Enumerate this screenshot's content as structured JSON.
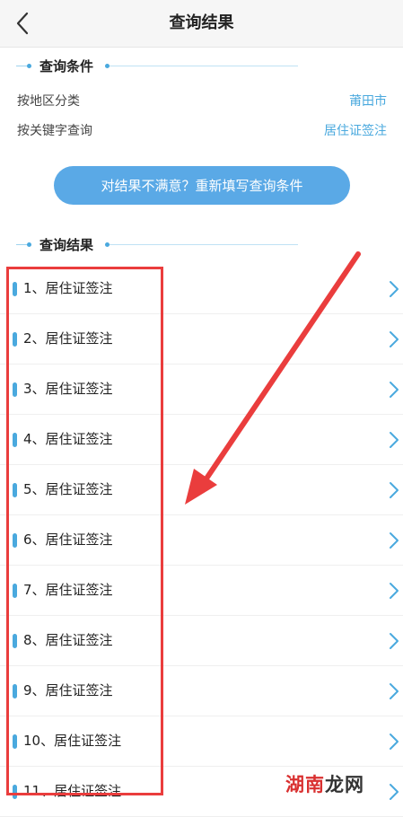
{
  "header": {
    "title": "查询结果"
  },
  "conditions": {
    "title": "查询条件",
    "rows": [
      {
        "label": "按地区分类",
        "value": "莆田市"
      },
      {
        "label": "按关键字查询",
        "value": "居住证签注"
      }
    ]
  },
  "refill_button": {
    "label": "对结果不满意？重新填写查询条件"
  },
  "results": {
    "title": "查询结果",
    "items": [
      {
        "label": "1、居住证签注"
      },
      {
        "label": "2、居住证签注"
      },
      {
        "label": "3、居住证签注"
      },
      {
        "label": "4、居住证签注"
      },
      {
        "label": "5、居住证签注"
      },
      {
        "label": "6、居住证签注"
      },
      {
        "label": "7、居住证签注"
      },
      {
        "label": "8、居住证签注"
      },
      {
        "label": "9、居住证签注"
      },
      {
        "label": "10、居住证签注"
      },
      {
        "label": "11、居住证签注"
      }
    ]
  },
  "watermark": {
    "part1": "湖南",
    "part2": "龙网"
  },
  "colors": {
    "accent": "#4aa9de",
    "button": "#5aa9e6",
    "annotation": "#ea3d3d"
  }
}
